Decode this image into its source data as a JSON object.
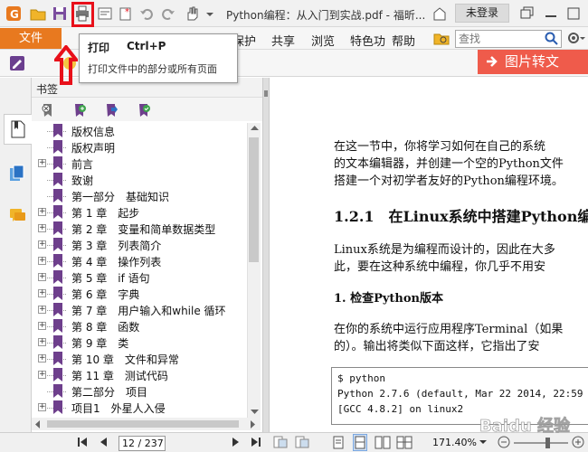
{
  "titlebar": {
    "doc_title": "Python编程：从入门到实战.pdf - 福昕...",
    "login_label": "未登录"
  },
  "menu": {
    "file": "文件",
    "items": [
      "保护",
      "共享",
      "浏览",
      "特色功",
      "帮助"
    ]
  },
  "search": {
    "placeholder": "查找"
  },
  "ad_banner": {
    "label": "图片转文"
  },
  "tooltip": {
    "title": "打印",
    "shortcut": "Ctrl+P",
    "desc": "打印文件中的部分或所有页面"
  },
  "bookmarks": {
    "title": "书签",
    "items": [
      {
        "label": "版权信息",
        "expandable": false
      },
      {
        "label": "版权声明",
        "expandable": false
      },
      {
        "label": "前言",
        "expandable": true
      },
      {
        "label": "致谢",
        "expandable": false
      },
      {
        "label": "第一部分　基础知识",
        "expandable": false
      },
      {
        "label": "第 1 章　起步",
        "expandable": true
      },
      {
        "label": "第 2 章　变量和简单数据类型",
        "expandable": true
      },
      {
        "label": "第 3 章　列表简介",
        "expandable": true
      },
      {
        "label": "第 4 章　操作列表",
        "expandable": true
      },
      {
        "label": "第 5 章　if 语句",
        "expandable": true
      },
      {
        "label": "第 6 章　字典",
        "expandable": true
      },
      {
        "label": "第 7 章　用户输入和while 循环",
        "expandable": true
      },
      {
        "label": "第 8 章　函数",
        "expandable": true
      },
      {
        "label": "第 9 章　类",
        "expandable": true
      },
      {
        "label": "第 10 章　文件和异常",
        "expandable": true
      },
      {
        "label": "第 11 章　测试代码",
        "expandable": true
      },
      {
        "label": "第二部分　项目",
        "expandable": false
      },
      {
        "label": "项目1　外星人入侵",
        "expandable": true
      }
    ]
  },
  "document": {
    "para1": [
      "在这一节中，你将学习如何在自己的系统",
      "的文本编辑器，并创建一个空的Python文件",
      "搭建一个对初学者友好的Python编程环境。"
    ],
    "section_heading": "1.2.1　在Linux系统中搭建Python编",
    "para2": [
      "Linux系统是为编程而设计的，因此在大多",
      "此，要在这种系统中编程，你几乎不用安"
    ],
    "subheading": "1. 检查Python版本",
    "para3": [
      "在你的系统中运行应用程序Terminal（如果",
      "的）。输出将类似下面这样，它指出了安"
    ],
    "code": [
      "$ python",
      "Python 2.7.6 (default, Mar 22 2014, 22:59",
      "[GCC 4.8.2] on linux2"
    ]
  },
  "statusbar": {
    "page_current": "12 / 237",
    "page_count": "",
    "zoom": "171.40%"
  },
  "watermark": {
    "text": "Baidu 经验"
  },
  "colors": {
    "file_menu": "#e8791f",
    "ad_banner": "#ef5b4b",
    "highlight": "#e8101a",
    "bookmark_flag": "#6e3f8c"
  }
}
